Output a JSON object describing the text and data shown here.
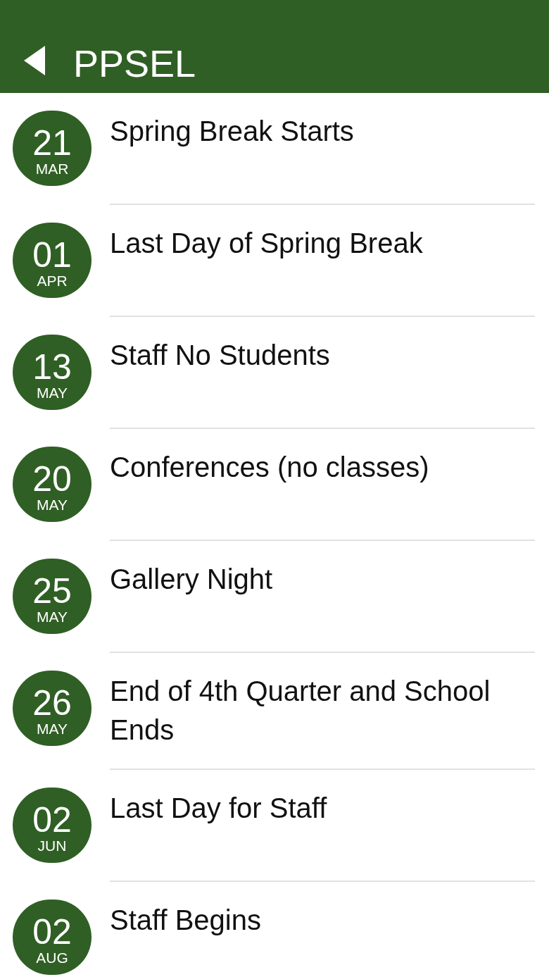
{
  "header": {
    "title": "PPSEL"
  },
  "events": [
    {
      "day": "21",
      "month": "MAR",
      "title": "Spring Break Starts"
    },
    {
      "day": "01",
      "month": "APR",
      "title": "Last Day of Spring Break"
    },
    {
      "day": "13",
      "month": "MAY",
      "title": "Staff No Students"
    },
    {
      "day": "20",
      "month": "MAY",
      "title": "Conferences (no classes)"
    },
    {
      "day": "25",
      "month": "MAY",
      "title": "Gallery Night"
    },
    {
      "day": "26",
      "month": "MAY",
      "title": "End of 4th Quarter and School Ends"
    },
    {
      "day": "02",
      "month": "JUN",
      "title": "Last Day for Staff"
    },
    {
      "day": "02",
      "month": "AUG",
      "title": "Staff Begins"
    }
  ]
}
